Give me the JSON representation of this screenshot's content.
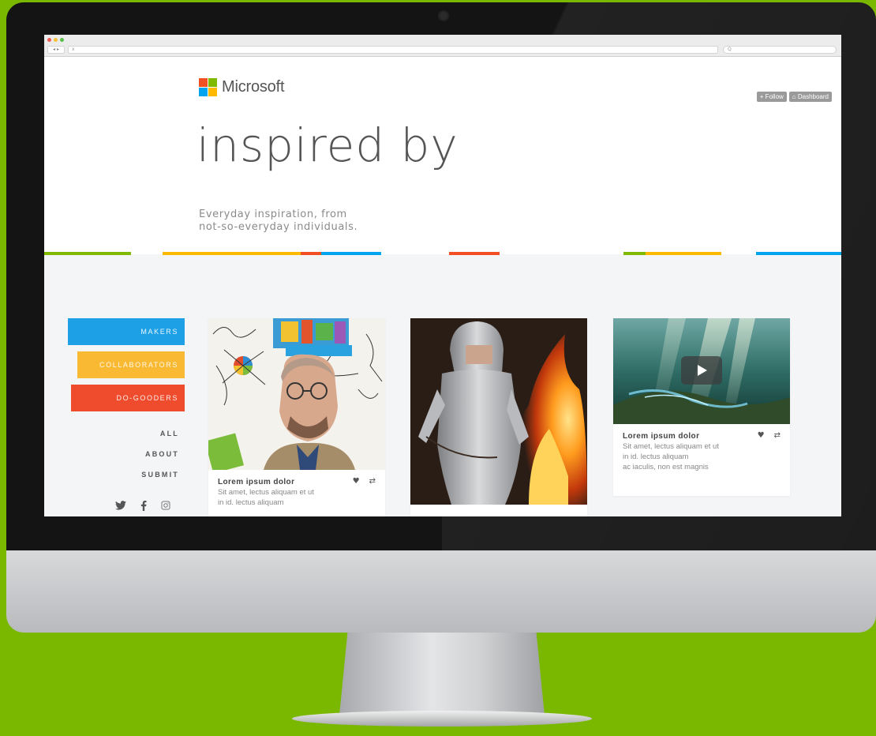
{
  "browser": {
    "url": "x",
    "search_placeholder": "Q",
    "nav_label": "◂ ▸"
  },
  "brand": {
    "name": "Microsoft",
    "logo_colors": [
      "#f25022",
      "#7fba00",
      "#00a4ef",
      "#ffb900"
    ]
  },
  "hero": {
    "title": "inspired by",
    "subtitle_line1": "Everyday inspiration, from",
    "subtitle_line2": "not-so-everyday individuals."
  },
  "top_actions": {
    "follow_label": "+ Follow",
    "dashboard_label": "⌂ Dashboard"
  },
  "divider_colors": [
    "#7fba00",
    "#ffb900",
    "#f25022",
    "#00a4ef"
  ],
  "categories": [
    {
      "label": "MAKERS",
      "color": "#1ea0e6"
    },
    {
      "label": "COLLABORATORS",
      "color": "#f9b933"
    },
    {
      "label": "DO-GOODERS",
      "color": "#ee4c2c"
    }
  ],
  "nav_links": {
    "all": "ALL",
    "about": "ABOUT",
    "submit": "SUBMIT"
  },
  "social_icons": [
    "twitter-icon",
    "facebook-icon",
    "instagram-icon"
  ],
  "cards": [
    {
      "title": "Lorem ipsum dolor",
      "line1": "Sit amet, lectus aliquam et ut",
      "line2": "in id. lectus aliquam"
    },
    {
      "title": "Lorem ipsum dolor",
      "line1": "Sit amet, lectus aliquam et ut",
      "line2": "in id. lectus aliquam",
      "line3": "ac iaculis, non est magnis"
    }
  ]
}
